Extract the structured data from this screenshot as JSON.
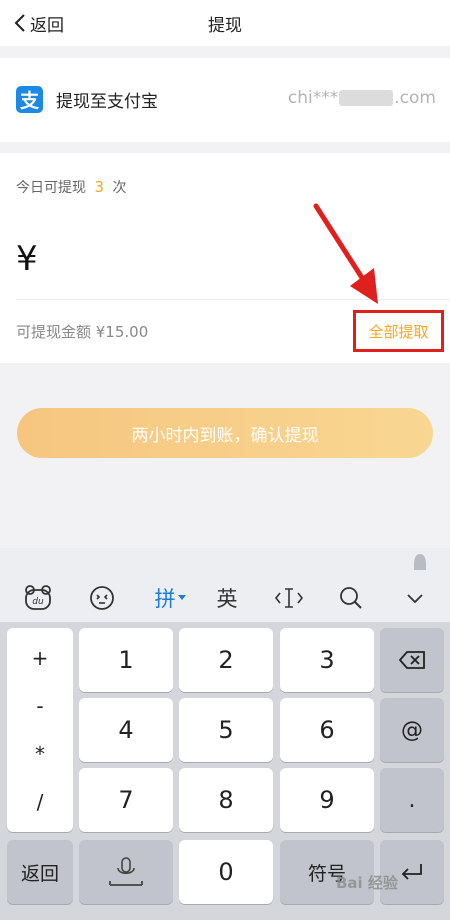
{
  "nav": {
    "back_label": "返回",
    "title": "提现"
  },
  "account": {
    "label": "提现至支付宝",
    "email_prefix": "chi***",
    "email_suffix": ".com",
    "logo_char": "支"
  },
  "amount": {
    "today_prefix": "今日可提现",
    "today_count": "3",
    "today_suffix": "次",
    "currency": "¥",
    "available_text": "可提现金额 ¥15.00",
    "withdraw_all_label": "全部提取"
  },
  "confirm_label": "两小时内到账，确认提现",
  "keyboard": {
    "toolbar": [
      "du",
      "☺",
      "拼",
      "英",
      "‹I›",
      "search",
      "chevron-down"
    ],
    "pinyin_label": "拼",
    "english_label": "英",
    "symbols_column": [
      "+",
      "-",
      "*",
      "/"
    ],
    "digits": [
      "1",
      "2",
      "3",
      "4",
      "5",
      "6",
      "7",
      "8",
      "9",
      "0"
    ],
    "at": "@",
    "dot": ".",
    "return_label": "返回",
    "symbol_label": "符号"
  },
  "watermark": "Bai 经验",
  "colors": {
    "accent_orange": "#f5a623",
    "alipay_blue": "#1e88e5",
    "highlight_red": "#e0201c"
  }
}
